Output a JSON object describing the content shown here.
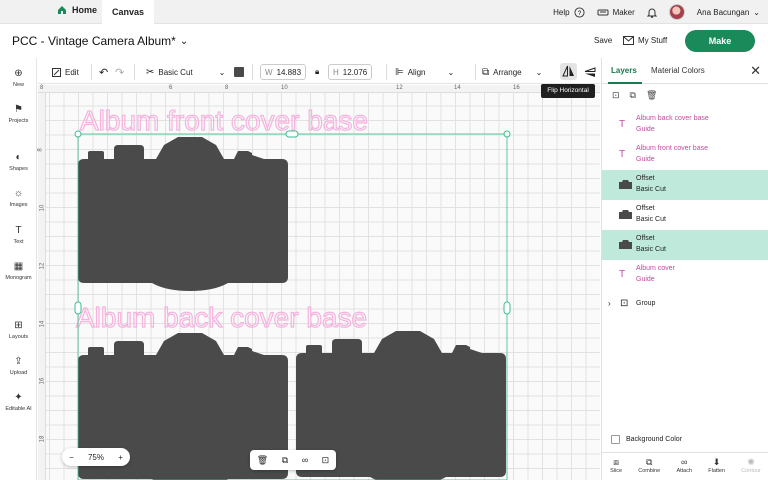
{
  "nav": {
    "home": "Home",
    "canvas": "Canvas",
    "help": "Help",
    "maker": "Maker",
    "user": "Ana Bacungan"
  },
  "title": {
    "project": "PCC - Vintage Camera Album*",
    "save": "Save",
    "my_stuff": "My Stuff",
    "make": "Make"
  },
  "toolbar": {
    "edit": "Edit",
    "operation": "Basic Cut",
    "w_label": "W",
    "w_value": "14.883",
    "h_label": "H",
    "h_value": "12.076",
    "align": "Align",
    "arrange": "Arrange",
    "tooltip": "Flip Horizontal",
    "fill_color": "#4a4a4a"
  },
  "leftbar": [
    {
      "label": "New",
      "icon": "plus-circle-icon"
    },
    {
      "label": "Projects",
      "icon": "projects-icon"
    },
    {
      "label": "Shapes",
      "icon": "shapes-icon"
    },
    {
      "label": "Images",
      "icon": "lightbulb-icon"
    },
    {
      "label": "Text",
      "icon": "text-icon"
    },
    {
      "label": "Monogram",
      "icon": "monogram-icon"
    },
    {
      "label": "Layouts",
      "icon": "layouts-icon"
    },
    {
      "label": "Upload",
      "icon": "upload-icon"
    },
    {
      "label": "Editable AI",
      "icon": "sparkle-icon"
    }
  ],
  "ruler": {
    "top": [
      "8",
      "6",
      "8",
      "10",
      "12",
      "14",
      "16"
    ],
    "left": [
      "8",
      "10",
      "12",
      "14",
      "16",
      "18"
    ]
  },
  "canvas": {
    "guide_front": "Album front cover base",
    "guide_back": "Album back cover base",
    "zoom": "75%",
    "zoom_minus": "−",
    "zoom_plus": "+"
  },
  "panel": {
    "tab_layers": "Layers",
    "tab_materials": "Material Colors",
    "layers": [
      {
        "name": "Album back cover base",
        "sub": "Guide",
        "kind": "text",
        "selected": false
      },
      {
        "name": "Album front cover base",
        "sub": "Guide",
        "kind": "text",
        "selected": false
      },
      {
        "name": "Offset",
        "sub": "Basic Cut",
        "kind": "shape",
        "selected": true
      },
      {
        "name": "Offset",
        "sub": "Basic Cut",
        "kind": "shape",
        "selected": false
      },
      {
        "name": "Offset",
        "sub": "Basic Cut",
        "kind": "shape",
        "selected": true
      },
      {
        "name": "Album cover",
        "sub": "Guide",
        "kind": "text",
        "selected": false
      }
    ],
    "group": "Group",
    "background_color": "Background Color",
    "bottom_tools": [
      "Slice",
      "Combine",
      "Attach",
      "Flatten",
      "Contour"
    ]
  },
  "colors": {
    "accent": "#1b8a5a",
    "guide_pink": "#f5b3df",
    "selection": "#bfeadb",
    "handle": "#36c08a"
  }
}
